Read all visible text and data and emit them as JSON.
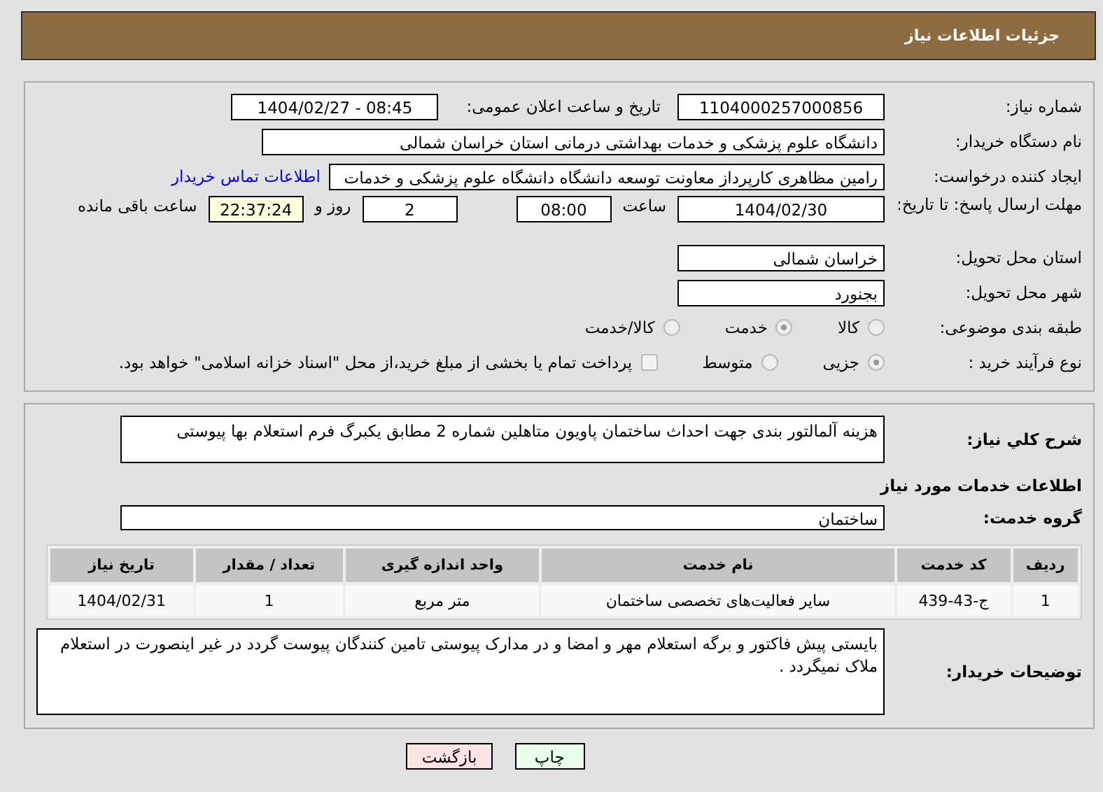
{
  "header": {
    "title": "جزئیات اطلاعات نیاز"
  },
  "need_number": {
    "label": "شماره نیاز:",
    "value": "1104000257000856"
  },
  "announce": {
    "label": "تاریخ و ساعت اعلان عمومی:",
    "value": "1404/02/27 - 08:45"
  },
  "buyer_org": {
    "label": "نام دستگاه خریدار:",
    "value": "دانشگاه علوم پزشکی و خدمات بهداشتی درمانی استان خراسان شمالی"
  },
  "requester": {
    "label": "ایجاد کننده درخواست:",
    "value": "رامین مظاهری کارپرداز معاونت توسعه دانشگاه دانشگاه علوم پزشکی و خدمات",
    "link": "اطلاعات تماس خریدار"
  },
  "deadline": {
    "label": "مهلت ارسال پاسخ: تا تاریخ:",
    "date": "1404/02/30",
    "time_label": "ساعت",
    "time": "08:00",
    "days": "2",
    "days_label": "روز و",
    "remaining": "22:37:24",
    "remaining_label": "ساعت باقی مانده"
  },
  "province": {
    "label": "استان محل تحویل:",
    "value": "خراسان شمالی"
  },
  "city": {
    "label": "شهر محل تحویل:",
    "value": "بجنورد"
  },
  "category": {
    "label": "طبقه بندی موضوعی:",
    "options": [
      {
        "label": "کالا",
        "selected": false
      },
      {
        "label": "خدمت",
        "selected": true
      },
      {
        "label": "کالا/خدمت",
        "selected": false
      }
    ]
  },
  "process": {
    "label": "نوع فرآیند خرید :",
    "options": [
      {
        "label": "جزیی",
        "selected": true
      },
      {
        "label": "متوسط",
        "selected": false
      }
    ],
    "payment": {
      "label": "پرداخت تمام یا بخشی از مبلغ خرید،از محل \"اسناد خزانه اسلامی\" خواهد بود.",
      "checked": false
    }
  },
  "description": {
    "label": "شرح کلي نياز:",
    "value": "هزینه آلمالتور بندی جهت احداث ساختمان پاویون متاهلین شماره 2 مطابق یکبرگ فرم استعلام بها پیوستی"
  },
  "services_heading": "اطلاعات خدمات مورد نياز",
  "service_group": {
    "label": "گروه خدمت:",
    "value": "ساختمان"
  },
  "table": {
    "columns": [
      "ردیف",
      "کد خدمت",
      "نام خدمت",
      "واحد اندازه گیری",
      "تعداد / مقدار",
      "تاریخ نیاز"
    ],
    "rows": [
      [
        "1",
        "ج-43-439",
        "سایر فعالیت‌های تخصصی ساختمان",
        "متر مربع",
        "1",
        "1404/02/31"
      ]
    ]
  },
  "buyer_notes": {
    "label": "توضیحات خریدار:",
    "value": "بایستی پیش فاکتور و برگه استعلام مهر و امضا و در مدارک پیوستی تامین کنندگان پیوست گردد در غیر اینصورت در استعلام ملاک نمیگردد ."
  },
  "buttons": [
    {
      "label": "چاپ",
      "kind": "print"
    },
    {
      "label": "بازگشت",
      "kind": "back"
    }
  ]
}
